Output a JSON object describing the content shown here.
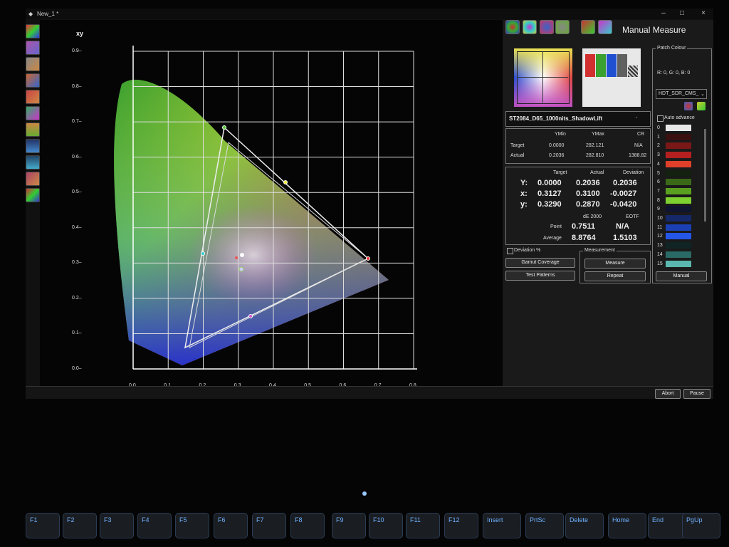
{
  "window": {
    "title": "New_1 *",
    "minimize": "–",
    "maximize": "□",
    "close": "×"
  },
  "plot": {
    "corner_label": "xy",
    "y_ticks": [
      "0.9",
      "0.8",
      "0.7",
      "0.6",
      "0.5",
      "0.4",
      "0.3",
      "0.2",
      "0.1",
      "0.0"
    ],
    "x_ticks": [
      "0.0",
      "0.1",
      "0.2",
      "0.3",
      "0.4",
      "0.5",
      "0.6",
      "0.7",
      "0.8"
    ]
  },
  "panel": {
    "title": "Manual Measure",
    "preset": "ST2084_D65_1000nits_ShadowLift",
    "preset_dash": "-",
    "range": {
      "headers": [
        "YMin",
        "YMax",
        "CR"
      ],
      "target_label": "Target",
      "actual_label": "Actual",
      "target": [
        "0.0000",
        "282.121",
        "N/A"
      ],
      "actual": [
        "0.2036",
        "282.810",
        "1388.82"
      ]
    },
    "meas": {
      "headers": [
        "Target",
        "Actual",
        "Deviation"
      ],
      "rows": [
        {
          "label": "Y:",
          "target": "0.0000",
          "actual": "0.2036",
          "deviation": "0.2036"
        },
        {
          "label": "x:",
          "target": "0.3127",
          "actual": "0.3100",
          "deviation": "-0.0027"
        },
        {
          "label": "y:",
          "target": "0.3290",
          "actual": "0.2870",
          "deviation": "-0.0420"
        }
      ],
      "de_label": "dE 2000",
      "eotf_label": "EOTF",
      "point_label": "Point",
      "point_de": "0.7511",
      "point_eotf": "N/A",
      "avg_label": "Average",
      "avg_de": "8.8764",
      "avg_eotf": "1.5103"
    },
    "deviation_pct": "Deviation %",
    "gamut_btn": "Gamut Coverage",
    "patterns_btn": "Test Patterns",
    "measurement_group": "Measurement",
    "measure_btn": "Measure",
    "repeat_btn": "Repeat"
  },
  "patch": {
    "group_title": "Patch Colour",
    "rgb": "R: 0, G: 0, B: 0",
    "dropdown": "HDT_SDR_CMS_",
    "auto_advance": "Auto advance",
    "manual_btn": "Manual",
    "swatches": [
      {
        "num": "0",
        "color": "#e8e8e8"
      },
      {
        "num": "1",
        "color": "#3a1010"
      },
      {
        "num": "2",
        "color": "#7a1818"
      },
      {
        "num": "3",
        "color": "#b42020"
      },
      {
        "num": "4",
        "color": "#e0402a"
      },
      {
        "num": "5",
        "color": "#142010"
      },
      {
        "num": "6",
        "color": "#3a6a18"
      },
      {
        "num": "7",
        "color": "#5aa020"
      },
      {
        "num": "8",
        "color": "#7ed030"
      },
      {
        "num": "9",
        "color": "#101430"
      },
      {
        "num": "10",
        "color": "#14286a"
      },
      {
        "num": "11",
        "color": "#1a40b4"
      },
      {
        "num": "12",
        "color": "#2456e8"
      },
      {
        "num": "13",
        "color": "#102424"
      },
      {
        "num": "14",
        "color": "#2a6a66"
      },
      {
        "num": "15",
        "color": "#5ab8b0"
      }
    ]
  },
  "status": {
    "abort": "Abort",
    "pause": "Pause"
  },
  "keyboard": [
    "F1",
    "F2",
    "F3",
    "F4",
    "F5",
    "F6",
    "F7",
    "F8",
    "F9",
    "F10",
    "F11",
    "F12",
    "Insert",
    "PrtSc",
    "Delete",
    "Home",
    "End",
    "PgUp"
  ]
}
